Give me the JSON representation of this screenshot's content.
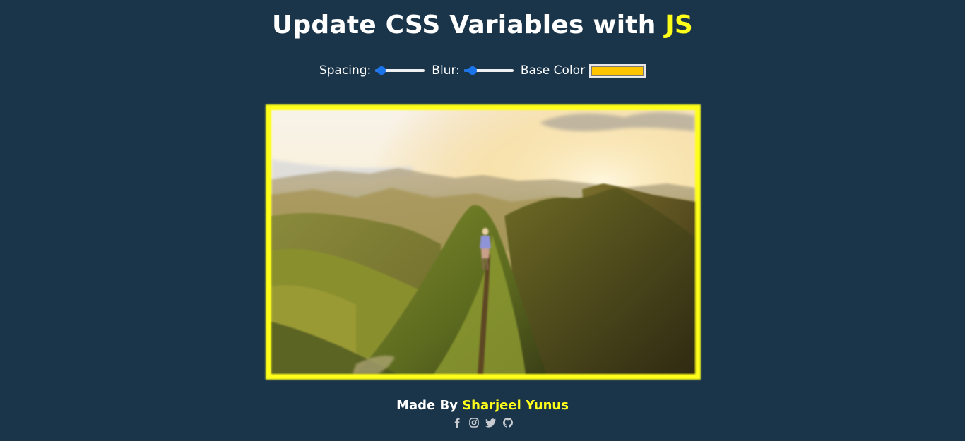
{
  "header": {
    "title_prefix": "Update CSS Variables with ",
    "title_highlight": "JS"
  },
  "controls": {
    "spacing_label": "Spacing:",
    "spacing_value_fraction": 0.05,
    "blur_label": "Blur:",
    "blur_value_fraction": 0.1,
    "base_color_label": "Base Color",
    "base_color_value": "#ffc600"
  },
  "photo": {
    "frame_color": "#ffff1a"
  },
  "footer": {
    "made_by": "Made By ",
    "author": "Sharjeel Yunus",
    "social_icons": [
      "facebook-icon",
      "instagram-icon",
      "twitter-icon",
      "github-icon"
    ]
  },
  "colors": {
    "background": "#1a344a",
    "accent": "#ffff1a",
    "slider_accent": "#1a73e8"
  }
}
